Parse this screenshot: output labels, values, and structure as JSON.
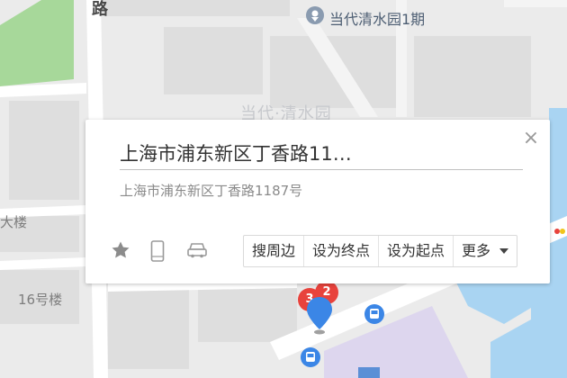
{
  "map": {
    "labels": {
      "road": "路",
      "poi": "当代清水园1期",
      "area": "当代·清水园",
      "building_big": "大楼",
      "building_16": "16号楼"
    },
    "markers": {
      "cluster_a": "3",
      "cluster_b": "2"
    },
    "colors": {
      "background": "#ebebeb",
      "block": "#dedede",
      "water": "#a9d4f2",
      "park": "#a7d89a",
      "cluster": "#e8423c",
      "pin": "#3b86e6",
      "bus": "#3b86e6",
      "lavender": "#ddd6ee"
    },
    "icons": [
      "poi-icon",
      "bus-stop-icon",
      "location-pin-icon",
      "traffic-light-icon"
    ]
  },
  "popup": {
    "title": "上海市浦东新区丁香路11…",
    "address": "上海市浦东新区丁香路1187号",
    "close_label": "×",
    "tools": [
      "favorite-star-icon",
      "phone-icon",
      "car-icon"
    ],
    "actions": {
      "nearby": "搜周边",
      "set_end": "设为终点",
      "set_start": "设为起点",
      "more": "更多"
    }
  }
}
